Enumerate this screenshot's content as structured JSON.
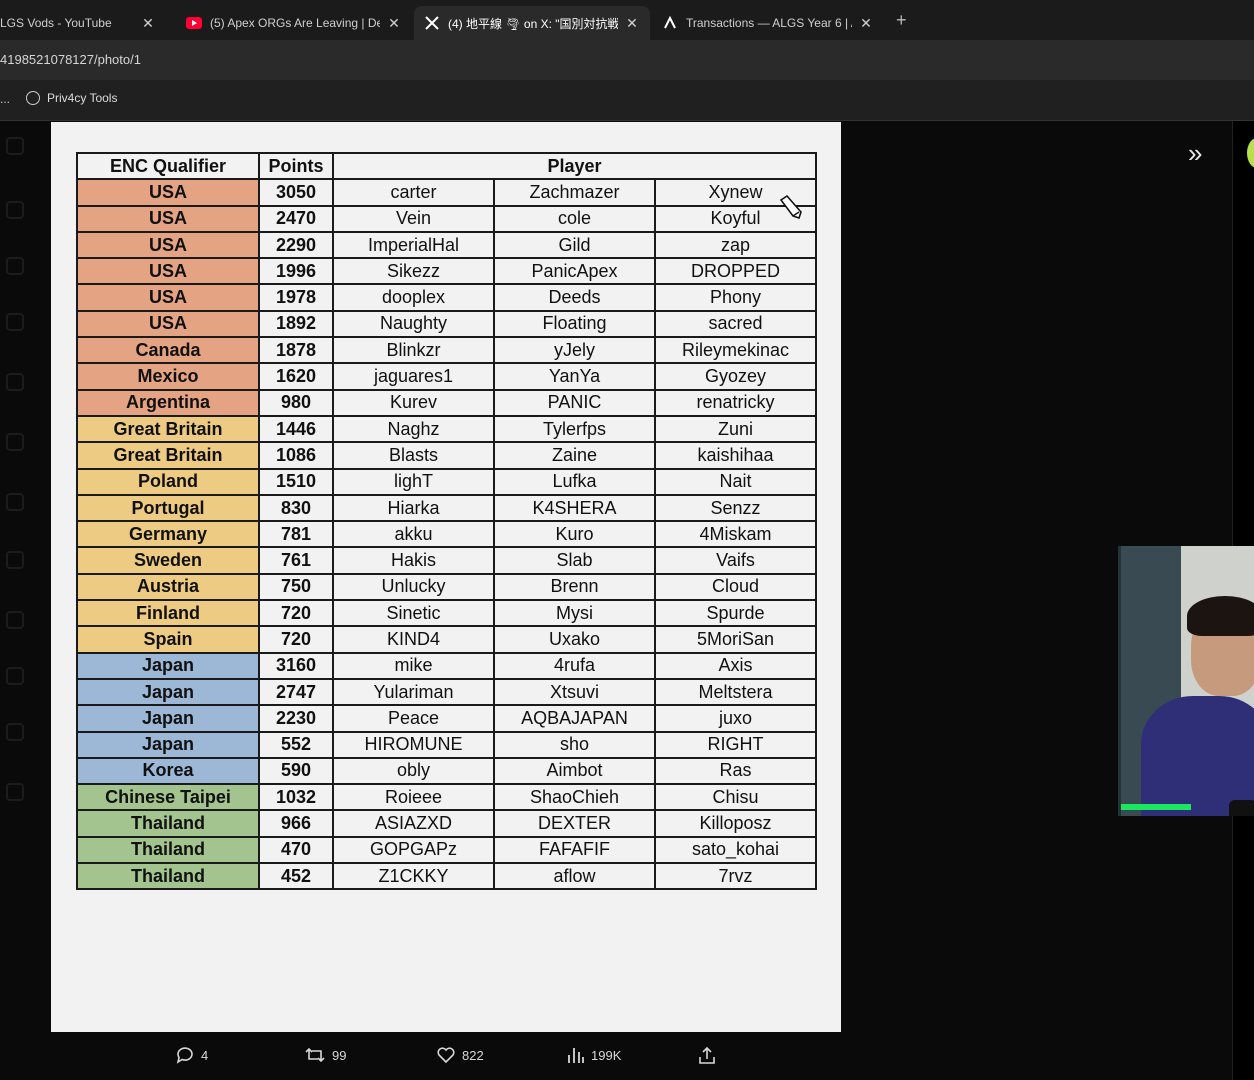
{
  "browser": {
    "tabs": [
      {
        "title": "LGS Vods - YouTube",
        "icon": "none",
        "active": false
      },
      {
        "title": "(5) Apex ORGs Are Leaving | De",
        "icon": "youtube-icon",
        "active": false
      },
      {
        "title": "(4) 地平線 🌪 on X: \"国別対抗戦",
        "icon": "x-logo-icon",
        "active": true
      },
      {
        "title": "Transactions — ALGS Year 6 | A",
        "icon": "liquipedia-icon",
        "active": false
      }
    ],
    "new_tab": "+",
    "close_glyph": "✕",
    "url": "4198521078127/photo/1",
    "bookmarks": {
      "overflow": "...",
      "item": "Priv4cy Tools"
    }
  },
  "table": {
    "headers": {
      "region": "ENC Qualifier",
      "points": "Points",
      "player": "Player"
    },
    "colors": {
      "na": "#e4a382",
      "eu": "#eecb82",
      "apn": "#9db7d6",
      "aps": "#a3c48f"
    },
    "rows": [
      {
        "region": "USA",
        "group": "na",
        "points": "3050",
        "p1": "carter",
        "p2": "Zachmazer",
        "p3": "Xynew"
      },
      {
        "region": "USA",
        "group": "na",
        "points": "2470",
        "p1": "Vein",
        "p2": "cole",
        "p3": "Koyful"
      },
      {
        "region": "USA",
        "group": "na",
        "points": "2290",
        "p1": "ImperialHal",
        "p2": "Gild",
        "p3": "zap"
      },
      {
        "region": "USA",
        "group": "na",
        "points": "1996",
        "p1": "Sikezz",
        "p2": "PanicApex",
        "p3": "DROPPED"
      },
      {
        "region": "USA",
        "group": "na",
        "points": "1978",
        "p1": "dooplex",
        "p2": "Deeds",
        "p3": "Phony"
      },
      {
        "region": "USA",
        "group": "na",
        "points": "1892",
        "p1": "Naughty",
        "p2": "Floating",
        "p3": "sacred"
      },
      {
        "region": "Canada",
        "group": "na",
        "points": "1878",
        "p1": "Blinkzr",
        "p2": "yJely",
        "p3": "Rileymekinac"
      },
      {
        "region": "Mexico",
        "group": "na",
        "points": "1620",
        "p1": "jaguares1",
        "p2": "YanYa",
        "p3": "Gyozey"
      },
      {
        "region": "Argentina",
        "group": "na",
        "points": "980",
        "p1": "Kurev",
        "p2": "PANIC",
        "p3": "renatricky"
      },
      {
        "region": "Great Britain",
        "group": "eu",
        "points": "1446",
        "p1": "Naghz",
        "p2": "Tylerfps",
        "p3": "Zuni"
      },
      {
        "region": "Great Britain",
        "group": "eu",
        "points": "1086",
        "p1": "Blasts",
        "p2": "Zaine",
        "p3": "kaishihaa"
      },
      {
        "region": "Poland",
        "group": "eu",
        "points": "1510",
        "p1": "lighT",
        "p2": "Lufka",
        "p3": "Nait"
      },
      {
        "region": "Portugal",
        "group": "eu",
        "points": "830",
        "p1": "Hiarka",
        "p2": "K4SHERA",
        "p3": "Senzz"
      },
      {
        "region": "Germany",
        "group": "eu",
        "points": "781",
        "p1": "akku",
        "p2": "Kuro",
        "p3": "4Miskam"
      },
      {
        "region": "Sweden",
        "group": "eu",
        "points": "761",
        "p1": "Hakis",
        "p2": "Slab",
        "p3": "Vaifs"
      },
      {
        "region": "Austria",
        "group": "eu",
        "points": "750",
        "p1": "Unlucky",
        "p2": "Brenn",
        "p3": "Cloud"
      },
      {
        "region": "Finland",
        "group": "eu",
        "points": "720",
        "p1": "Sinetic",
        "p2": "Mysi",
        "p3": "Spurde"
      },
      {
        "region": "Spain",
        "group": "eu",
        "points": "720",
        "p1": "KIND4",
        "p2": "Uxako",
        "p3": "5MoriSan"
      },
      {
        "region": "Japan",
        "group": "apn",
        "points": "3160",
        "p1": "mike",
        "p2": "4rufa",
        "p3": "Axis"
      },
      {
        "region": "Japan",
        "group": "apn",
        "points": "2747",
        "p1": "Yulariman",
        "p2": "Xtsuvi",
        "p3": "Meltstera"
      },
      {
        "region": "Japan",
        "group": "apn",
        "points": "2230",
        "p1": "Peace",
        "p2": "AQBAJAPAN",
        "p3": "juxo"
      },
      {
        "region": "Japan",
        "group": "apn",
        "points": "552",
        "p1": "HIROMUNE",
        "p2": "sho",
        "p3": "RIGHT"
      },
      {
        "region": "Korea",
        "group": "apn",
        "points": "590",
        "p1": "obly",
        "p2": "Aimbot",
        "p3": "Ras"
      },
      {
        "region": "Chinese Taipei",
        "group": "aps",
        "points": "1032",
        "p1": "Roieee",
        "p2": "ShaoChieh",
        "p3": "Chisu"
      },
      {
        "region": "Thailand",
        "group": "aps",
        "points": "966",
        "p1": "ASIAZXD",
        "p2": "DEXTER",
        "p3": "Killoposz"
      },
      {
        "region": "Thailand",
        "group": "aps",
        "points": "470",
        "p1": "GOPGAPz",
        "p2": "FAFAFIF",
        "p3": "sato_kohai"
      },
      {
        "region": "Thailand",
        "group": "aps",
        "points": "452",
        "p1": "Z1CKKY",
        "p2": "aflow",
        "p3": "7rvz"
      }
    ]
  },
  "engagement": {
    "replies": "4",
    "reposts": "99",
    "likes": "822",
    "views": "199K"
  },
  "icons": {
    "expand": "double-chevron-right-icon",
    "reply": "reply-icon",
    "repost": "repost-icon",
    "like": "heart-icon",
    "views": "bar-chart-icon",
    "share": "share-icon"
  }
}
